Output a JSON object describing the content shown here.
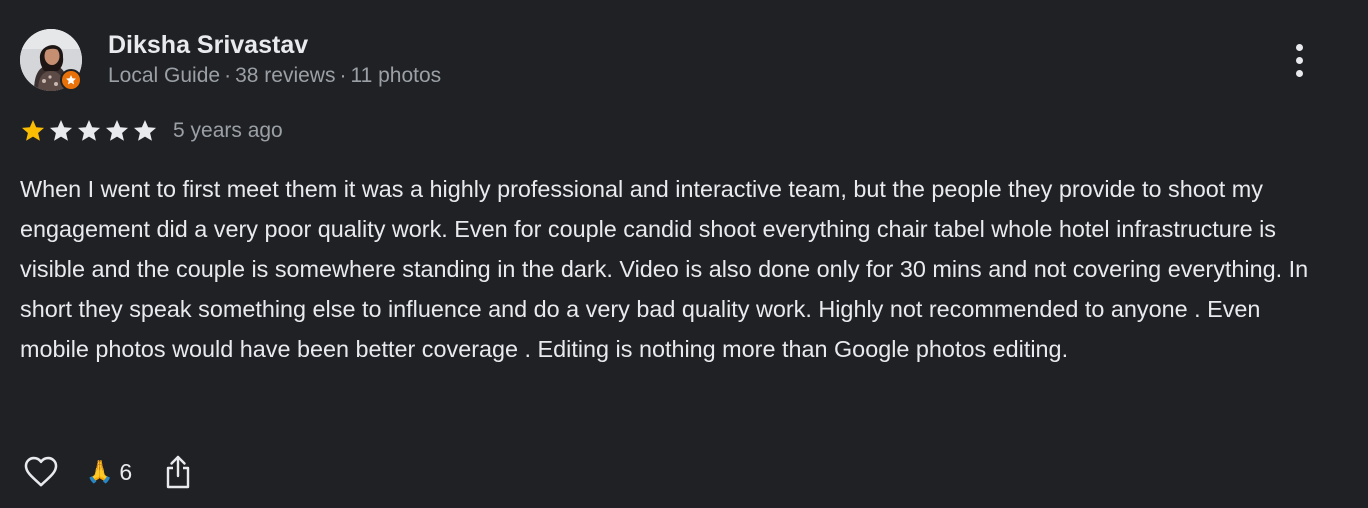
{
  "colors": {
    "background": "#202124",
    "primary_text": "#e8eaed",
    "secondary_text": "#9aa0a6",
    "star_filled": "#fbbc04",
    "star_empty": "#e8eaed",
    "local_guide_badge": "#e8710a"
  },
  "author": {
    "name": "Diksha Srivastav",
    "badge": "Local Guide",
    "separator": "·",
    "reviews_count": "38 reviews",
    "photos_count": "11 photos",
    "avatar_icon": "profile-photo",
    "badge_icon": "local-guide-star-icon"
  },
  "review": {
    "rating": 1,
    "max_rating": 5,
    "date": "5 years ago",
    "text": "When I went to first meet them it was a highly professional and interactive team, but the people they provide to shoot my engagement did a very poor quality work. Even for couple candid shoot everything chair tabel whole hotel infrastructure is visible and the couple is somewhere standing in the dark. Video is also done only for 30 mins and not covering everything. In short they speak something else to influence and do a very bad quality work. Highly not recommended to anyone . Even mobile photos would have been better coverage . Editing is nothing more than Google photos editing."
  },
  "actions": {
    "like_icon": "heart-outline-icon",
    "reaction_emoji": "🙏",
    "reaction_count": "6",
    "share_icon": "share-icon",
    "more_icon": "more-vertical-icon"
  }
}
